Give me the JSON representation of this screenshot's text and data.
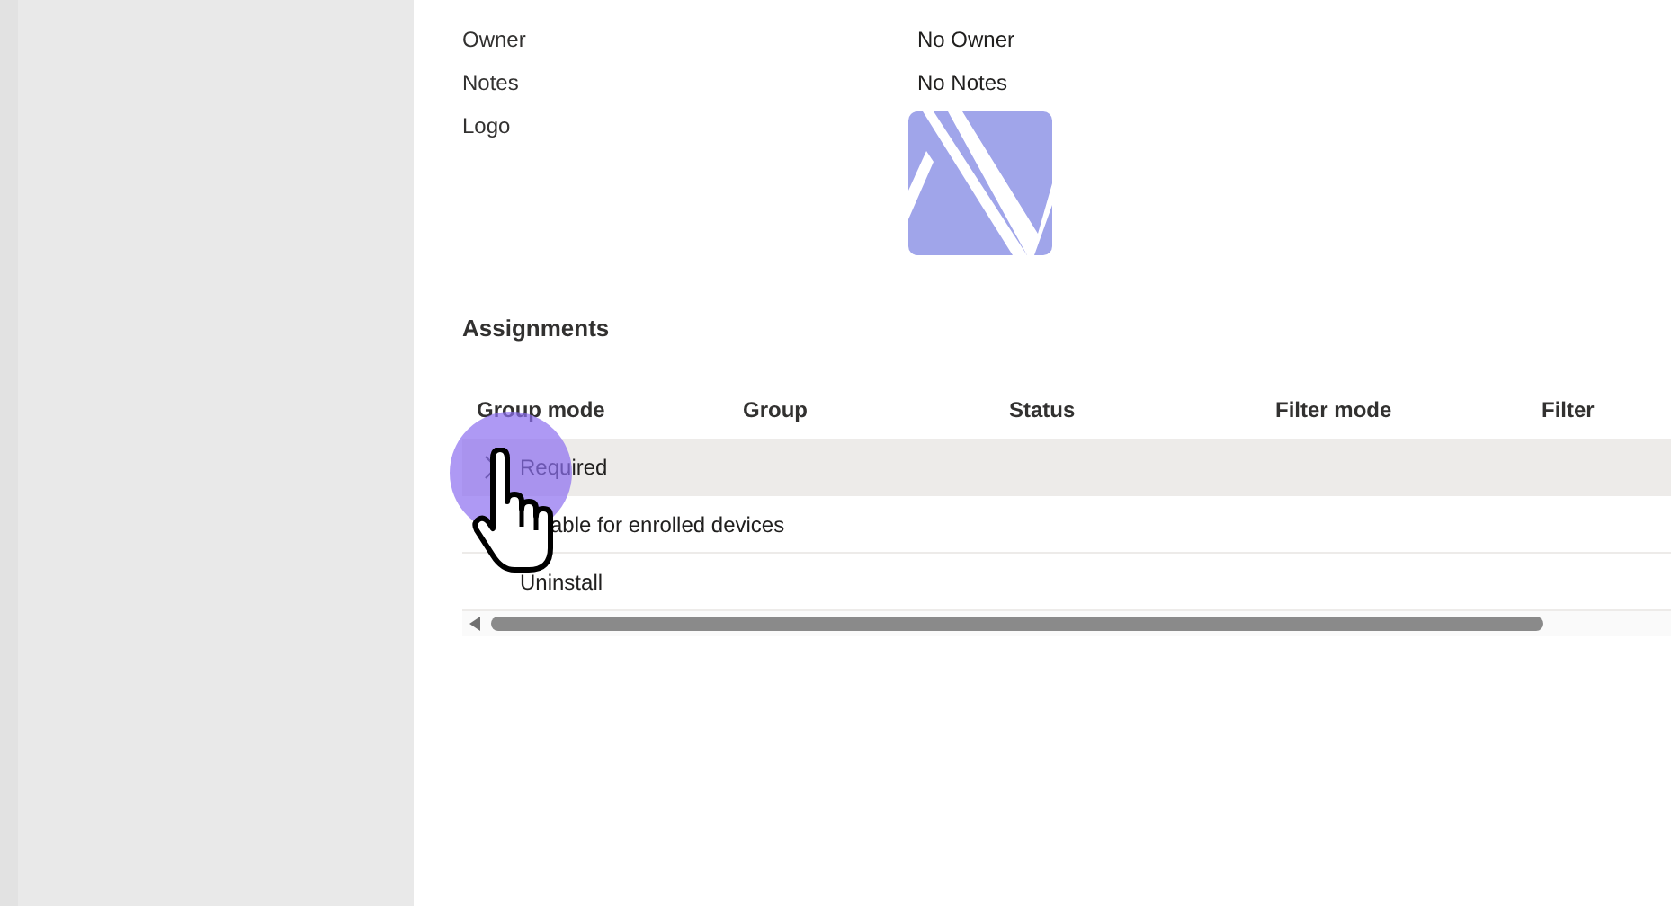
{
  "properties": [
    {
      "label": "Owner",
      "value": "No Owner"
    },
    {
      "label": "Notes",
      "value": "No Notes"
    },
    {
      "label": "Logo",
      "kind": "logo"
    }
  ],
  "assignments": {
    "title": "Assignments",
    "columns": [
      "Group mode",
      "Group",
      "Status",
      "Filter mode",
      "Filter"
    ],
    "rows": [
      {
        "group_mode": "Required",
        "hovered": true
      },
      {
        "group_mode": "able for enrolled devices",
        "hovered": false,
        "covered": true
      },
      {
        "group_mode": "Uninstall",
        "hovered": false
      }
    ]
  }
}
